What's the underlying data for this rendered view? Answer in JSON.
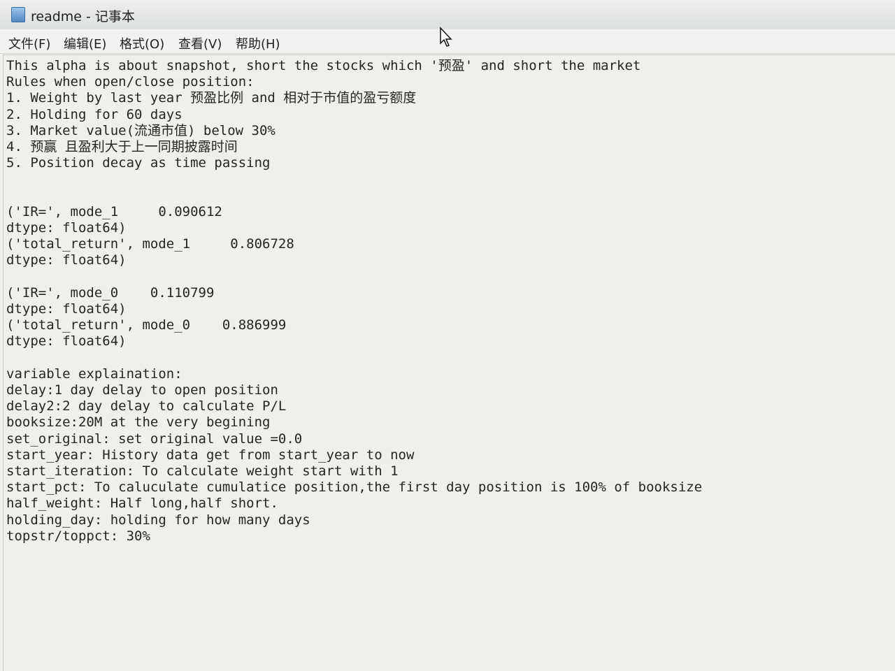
{
  "window": {
    "title": "readme - 记事本"
  },
  "menu": {
    "items": [
      {
        "label": "文件(F)"
      },
      {
        "label": "编辑(E)"
      },
      {
        "label": "格式(O)"
      },
      {
        "label": "查看(V)"
      },
      {
        "label": "帮助(H)"
      }
    ]
  },
  "editor": {
    "lines": [
      "This alpha is about snapshot, short the stocks which '预盈' and short the market",
      "Rules when open/close position:",
      "1. Weight by last year 预盈比例 and 相对于市值的盈亏额度",
      "2. Holding for 60 days",
      "3. Market value(流通市值) below 30%",
      "4. 预赢 且盈利大于上一同期披露时间",
      "5. Position decay as time passing",
      "",
      "",
      "('IR=', mode_1     0.090612",
      "dtype: float64)",
      "('total_return', mode_1     0.806728",
      "dtype: float64)",
      "",
      "('IR=', mode_0    0.110799",
      "dtype: float64)",
      "('total_return', mode_0    0.886999",
      "dtype: float64)",
      "",
      "variable explaination:",
      "delay:1 day delay to open position",
      "delay2:2 day delay to calculate P/L",
      "booksize:20M at the very begining",
      "set_original: set original value =0.0",
      "start_year: History data get from start_year to now",
      "start_iteration: To calculate weight start with 1",
      "start_pct: To caluculate cumulatice position,the first day position is 100% of booksize",
      "half_weight: Half long,half short.",
      "holding_day: holding for how many days",
      "topstr/toppct: 30%"
    ]
  }
}
